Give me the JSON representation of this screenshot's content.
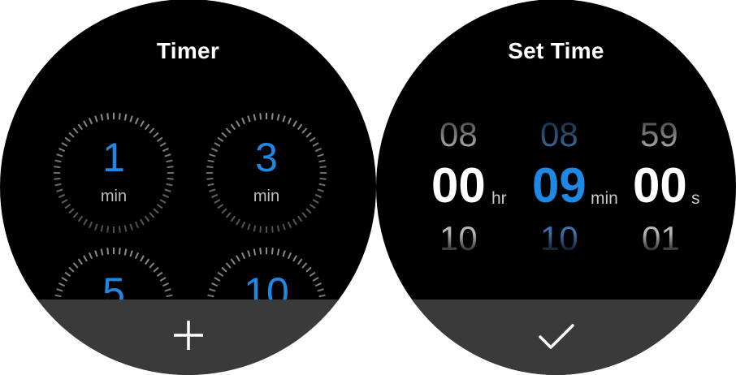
{
  "timer_screen": {
    "title": "Timer",
    "presets": [
      {
        "value": "1",
        "unit": "min"
      },
      {
        "value": "3",
        "unit": "min"
      },
      {
        "value": "5",
        "unit": ""
      },
      {
        "value": "10",
        "unit": ""
      }
    ],
    "bottom_action_icon": "plus-icon"
  },
  "set_time_screen": {
    "title": "Set Time",
    "hours": {
      "prev": "08",
      "current": "00",
      "next": "10",
      "label": "hr"
    },
    "minutes": {
      "prev": "08",
      "current": "09",
      "next": "10",
      "label": "min"
    },
    "seconds": {
      "prev": "59",
      "current": "00",
      "next": "01",
      "label": "s"
    },
    "bottom_action_icon": "checkmark-icon"
  },
  "colors": {
    "background": "#000000",
    "accent": "#1e88e5",
    "bottom_bar": "#3a3a3a",
    "text": "#ffffff"
  }
}
